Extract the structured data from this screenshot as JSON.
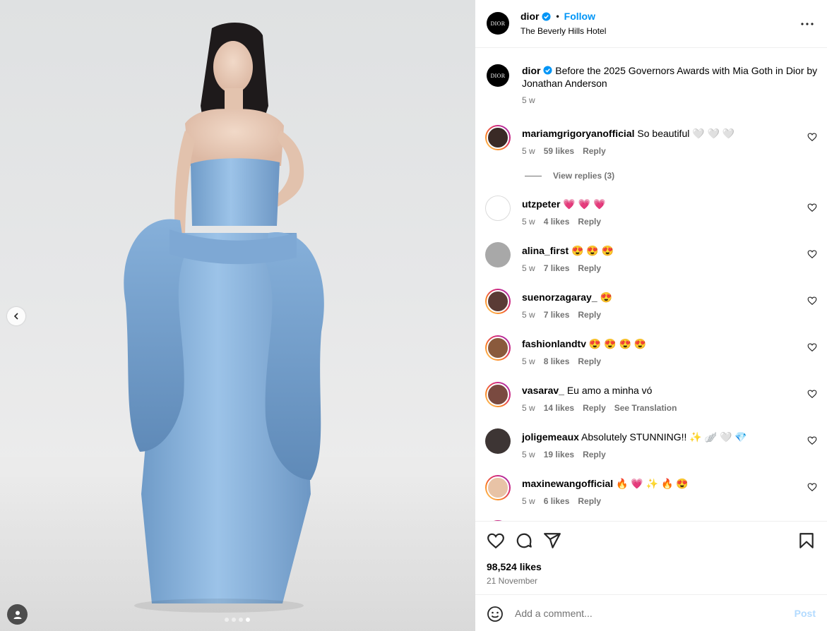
{
  "colors": {
    "accent": "#0095f6",
    "muted": "#737373",
    "dress": "#8ab4dc",
    "post_disabled": "#b3dbff"
  },
  "media": {
    "dot_count": 4,
    "active_dot": 3
  },
  "header": {
    "username": "dior",
    "follow_label": "Follow",
    "location": "The Beverly Hills Hotel",
    "avatar_text": "DIOR"
  },
  "caption": {
    "username": "dior",
    "text": "Before the 2025 Governors Awards with Mia Goth in Dior by Jonathan Anderson",
    "time": "5 w"
  },
  "comments": [
    {
      "username": "mariamgrigoryanofficial",
      "text": "So beautiful 🤍 🤍 🤍",
      "time": "5 w",
      "likes": "59 likes",
      "reply": "Reply",
      "view_replies": "View replies (3)",
      "avatar_style": "ring",
      "avatar_color": "#3a2a26"
    },
    {
      "username": "utzpeter",
      "text": "💗 💗 💗",
      "time": "5 w",
      "likes": "4 likes",
      "reply": "Reply",
      "avatar_style": "plain",
      "avatar_color": "#ffffff"
    },
    {
      "username": "alina_first",
      "text": "😍 😍 😍",
      "time": "5 w",
      "likes": "7 likes",
      "reply": "Reply",
      "avatar_style": "none",
      "avatar_color": "#a8a8a8"
    },
    {
      "username": "suenorzagaray_",
      "text": "😍",
      "time": "5 w",
      "likes": "7 likes",
      "reply": "Reply",
      "avatar_style": "ring",
      "avatar_color": "#5a3b35"
    },
    {
      "username": "fashionlandtv",
      "text": "😍 😍 😍 😍",
      "time": "5 w",
      "likes": "8 likes",
      "reply": "Reply",
      "avatar_style": "ring",
      "avatar_color": "#8a5a3c"
    },
    {
      "username": "vasarav_",
      "text": "Eu amo a minha vó",
      "time": "5 w",
      "likes": "14 likes",
      "reply": "Reply",
      "see_translation": "See Translation",
      "avatar_style": "ring",
      "avatar_color": "#7a4a40"
    },
    {
      "username": "joligemeaux",
      "text": "Absolutely STUNNING!! ✨ 🪽 🤍 💎",
      "time": "5 w",
      "likes": "19 likes",
      "reply": "Reply",
      "avatar_style": "none",
      "avatar_color": "#3d3534"
    },
    {
      "username": "maxinewangofficial",
      "text": "🔥 💗 ✨ 🔥 😍",
      "time": "5 w",
      "likes": "6 likes",
      "reply": "Reply",
      "avatar_style": "ring",
      "avatar_color": "#e8c3a6"
    }
  ],
  "actions": {
    "likes": "98,524 likes",
    "date": "21 November",
    "icons": [
      "heart-icon",
      "comment-icon",
      "share-icon",
      "bookmark-icon"
    ]
  },
  "add_comment": {
    "placeholder": "Add a comment...",
    "post_label": "Post"
  }
}
